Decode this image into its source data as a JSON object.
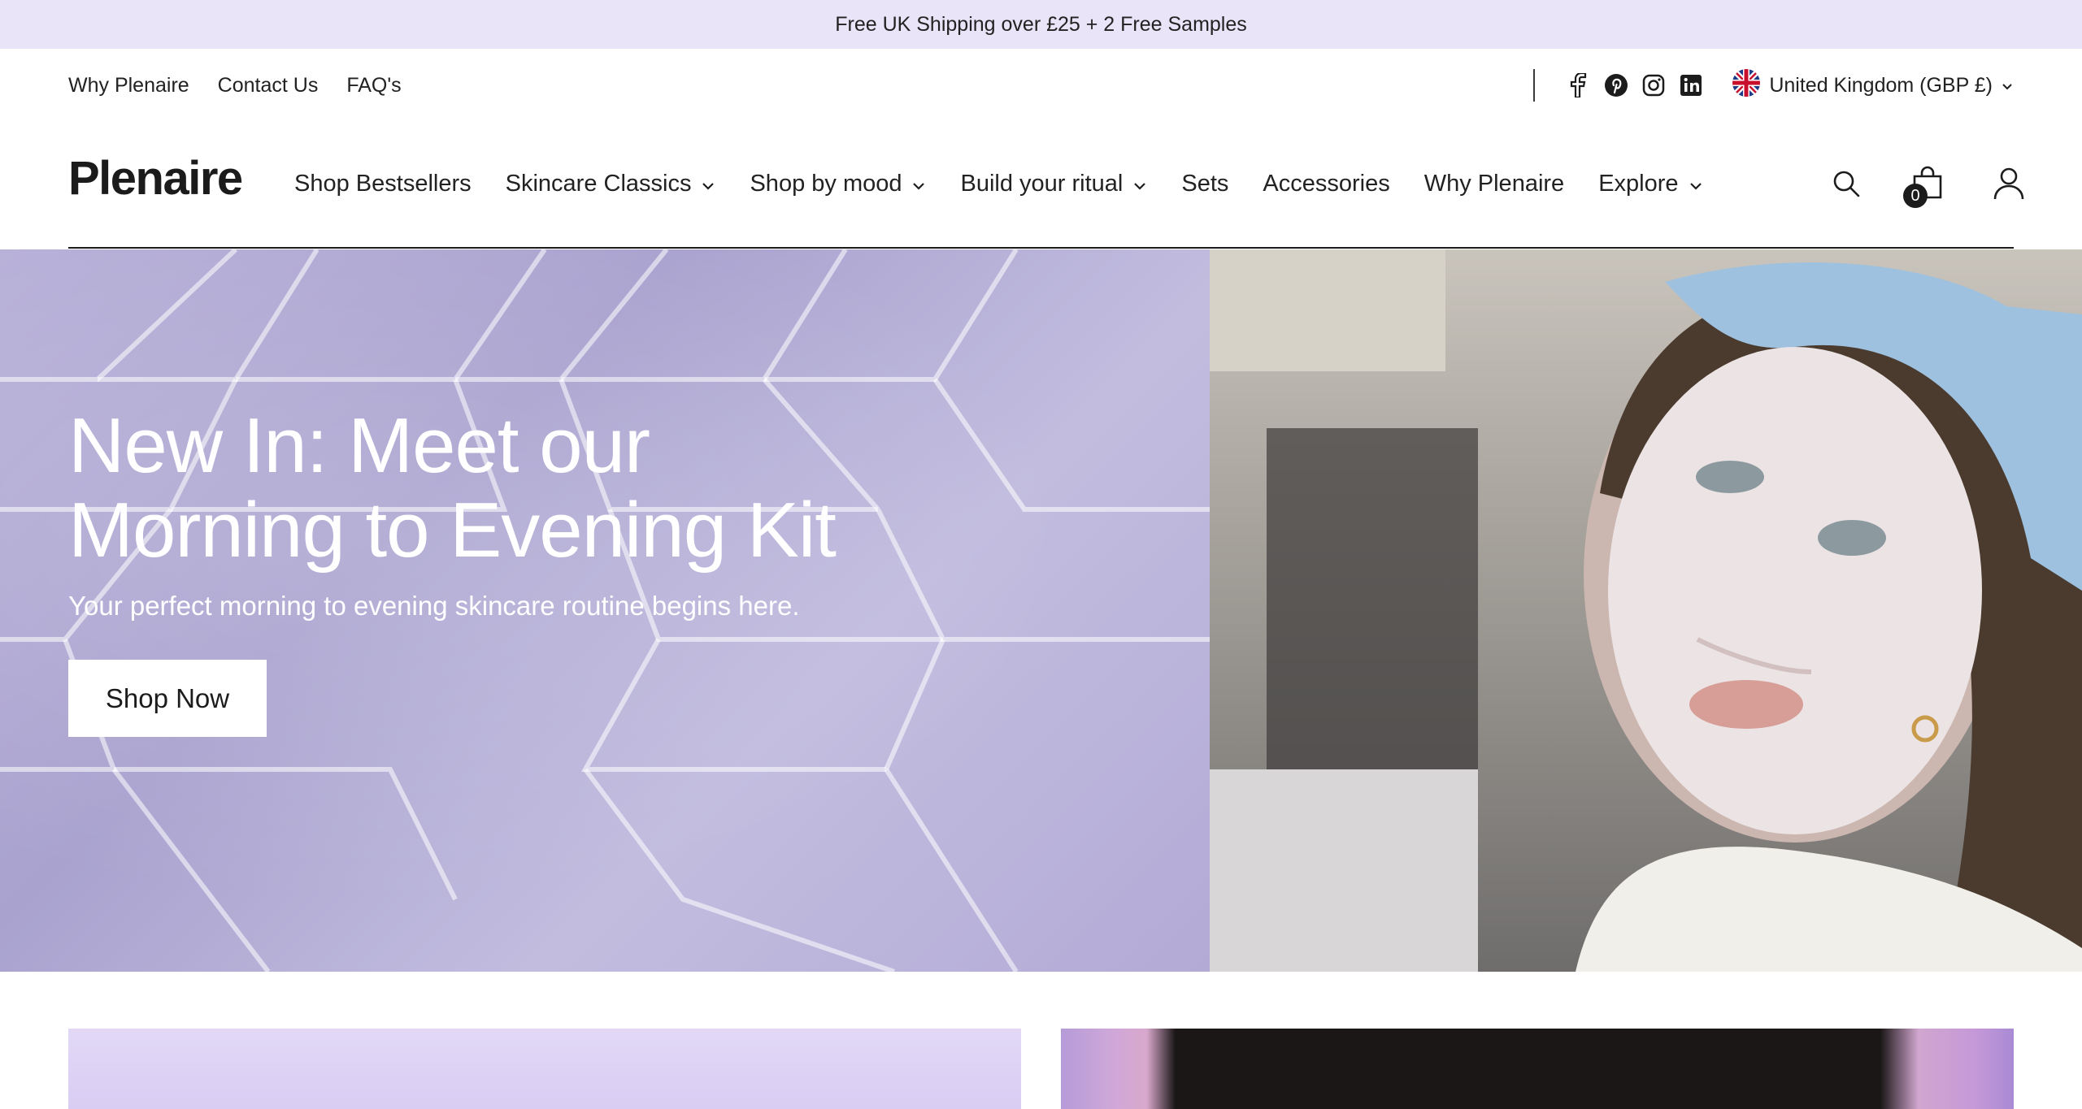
{
  "announcement": {
    "text": "Free UK Shipping over £25 + 2 Free Samples"
  },
  "utility": {
    "links": [
      "Why Plenaire",
      "Contact Us",
      "FAQ's"
    ],
    "social_icons": [
      "facebook-icon",
      "pinterest-icon",
      "instagram-icon",
      "linkedin-icon"
    ],
    "country": "United Kingdom (GBP £)"
  },
  "header": {
    "logo": "Plenaire",
    "nav": [
      {
        "label": "Shop Bestsellers",
        "dropdown": false
      },
      {
        "label": "Skincare Classics",
        "dropdown": true
      },
      {
        "label": "Shop by mood",
        "dropdown": true
      },
      {
        "label": "Build your ritual",
        "dropdown": true
      },
      {
        "label": "Sets",
        "dropdown": false
      },
      {
        "label": "Accessories",
        "dropdown": false
      },
      {
        "label": "Why Plenaire",
        "dropdown": false
      },
      {
        "label": "Explore",
        "dropdown": true
      }
    ],
    "cart_count": "0"
  },
  "hero": {
    "title_line1": "New In: Meet our",
    "title_line2": "Morning to Evening Kit",
    "subtitle": "Your perfect morning to evening skincare routine begins here.",
    "cta": "Shop Now"
  },
  "colors": {
    "announcement_bg": "#e9e4f8",
    "text": "#1c1c1c",
    "hero_lavender": "#b7b0d8"
  }
}
